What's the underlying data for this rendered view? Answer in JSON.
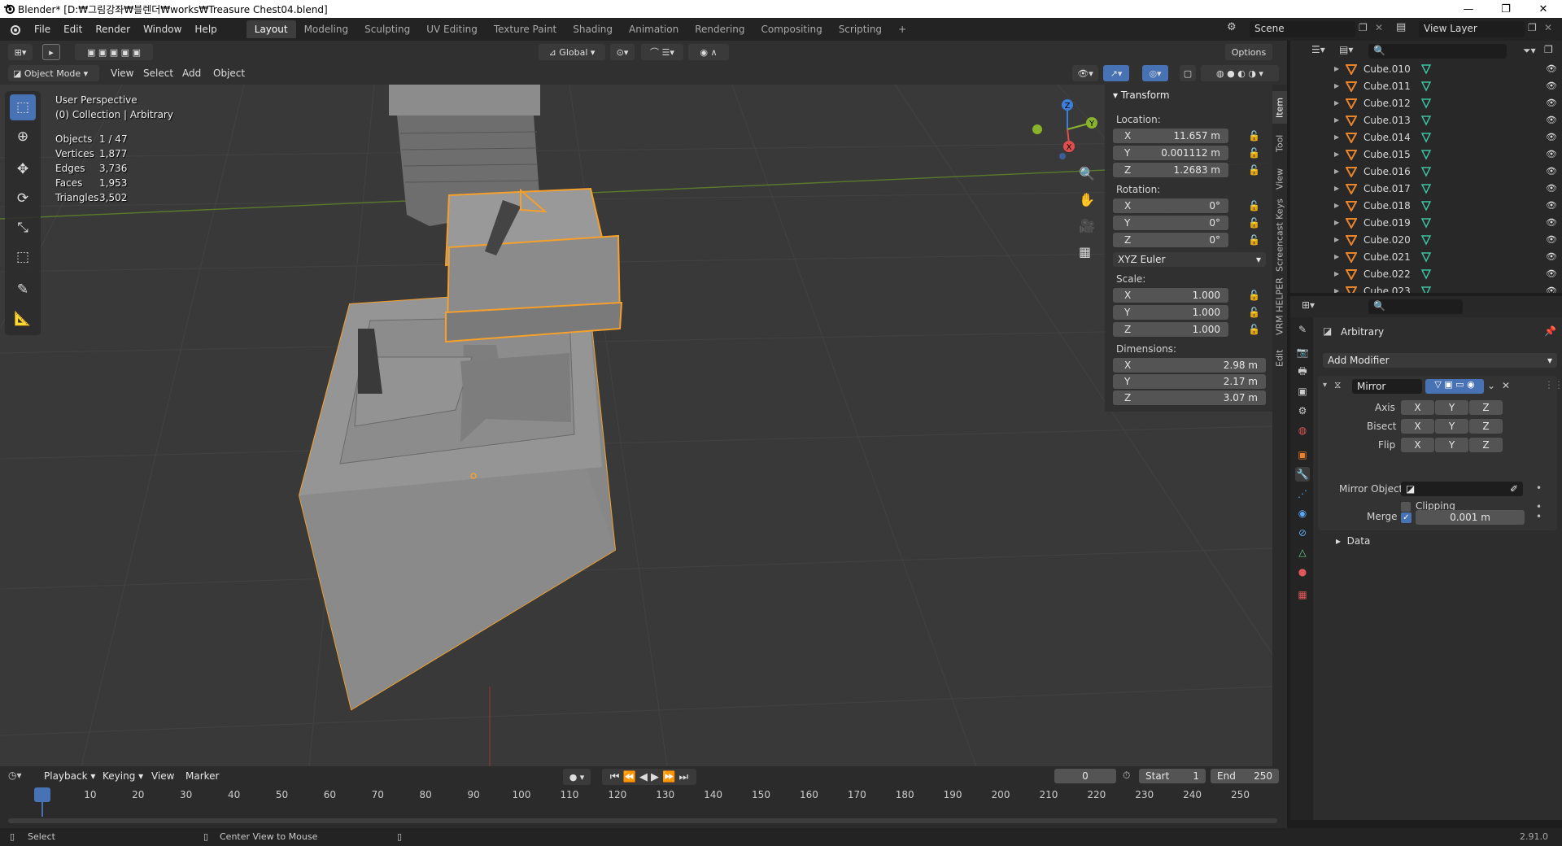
{
  "window": {
    "title": "Blender* [D:₩그림강좌₩블렌더₩works₩Treasure Chest04.blend]",
    "minimize": "—",
    "maximize": "❐",
    "close": "✕"
  },
  "menus": [
    "File",
    "Edit",
    "Render",
    "Window",
    "Help"
  ],
  "workspaces": [
    "Layout",
    "Modeling",
    "Sculpting",
    "UV Editing",
    "Texture Paint",
    "Shading",
    "Animation",
    "Rendering",
    "Compositing",
    "Scripting",
    "+"
  ],
  "scene": {
    "label": "Scene",
    "view_layer": "View Layer"
  },
  "header": {
    "orientation": "Global",
    "options": "Options",
    "mode": "Object Mode",
    "view": "View",
    "select": "Select",
    "add": "Add",
    "object": "Object"
  },
  "overlay_info": {
    "perspective": "User Perspective",
    "collection": "(0) Collection | Arbitrary",
    "stats": [
      {
        "k": "Objects",
        "v": "1 / 47"
      },
      {
        "k": "Vertices",
        "v": "1,877"
      },
      {
        "k": "Edges",
        "v": "3,736"
      },
      {
        "k": "Faces",
        "v": "1,953"
      },
      {
        "k": "Triangles",
        "v": "3,502"
      }
    ]
  },
  "gizmo": {
    "z": "Z",
    "y": "Y",
    "x": "X"
  },
  "npanel": {
    "title": "Transform",
    "location": "Location:",
    "rotation": "Rotation:",
    "scale": "Scale:",
    "dimensions": "Dimensions:",
    "euler": "XYZ Euler",
    "loc": [
      {
        "a": "X",
        "v": "11.657 m"
      },
      {
        "a": "Y",
        "v": "0.001112 m"
      },
      {
        "a": "Z",
        "v": "1.2683 m"
      }
    ],
    "rot": [
      {
        "a": "X",
        "v": "0°"
      },
      {
        "a": "Y",
        "v": "0°"
      },
      {
        "a": "Z",
        "v": "0°"
      }
    ],
    "scl": [
      {
        "a": "X",
        "v": "1.000"
      },
      {
        "a": "Y",
        "v": "1.000"
      },
      {
        "a": "Z",
        "v": "1.000"
      }
    ],
    "dim": [
      {
        "a": "X",
        "v": "2.98 m"
      },
      {
        "a": "Y",
        "v": "2.17 m"
      },
      {
        "a": "Z",
        "v": "3.07 m"
      }
    ],
    "tabs": [
      "Item",
      "Tool",
      "View",
      "Screencast Keys",
      "VRM HELPER",
      "Edit"
    ]
  },
  "outliner": {
    "items": [
      "Cube.010",
      "Cube.011",
      "Cube.012",
      "Cube.013",
      "Cube.014",
      "Cube.015",
      "Cube.016",
      "Cube.017",
      "Cube.018",
      "Cube.019",
      "Cube.020",
      "Cube.021",
      "Cube.022",
      "Cube.023"
    ]
  },
  "properties": {
    "object": "Arbitrary",
    "add_modifier": "Add Modifier",
    "modifier_name": "Mirror",
    "axis": "Axis",
    "bisect": "Bisect",
    "flip": "Flip",
    "xyz": [
      "X",
      "Y",
      "Z"
    ],
    "mirror_object": "Mirror Object",
    "clipping": "Clipping",
    "merge": "Merge",
    "merge_value": "0.001 m",
    "data": "Data"
  },
  "timeline": {
    "playback": "Playback",
    "keying": "Keying",
    "view": "View",
    "marker": "Marker",
    "current": "0",
    "start_label": "Start",
    "start": "1",
    "end_label": "End",
    "end": "250",
    "ticks": [
      "0",
      "10",
      "20",
      "30",
      "40",
      "50",
      "60",
      "70",
      "80",
      "90",
      "100",
      "110",
      "120",
      "130",
      "140",
      "150",
      "160",
      "170",
      "180",
      "190",
      "200",
      "210",
      "220",
      "230",
      "240",
      "250"
    ]
  },
  "status": {
    "select": "Select",
    "center": "Center View to Mouse",
    "version": "2.91.0"
  },
  "colors": {
    "selection": "#f5a02a",
    "accent": "#4772b3",
    "bg": "#393939"
  }
}
